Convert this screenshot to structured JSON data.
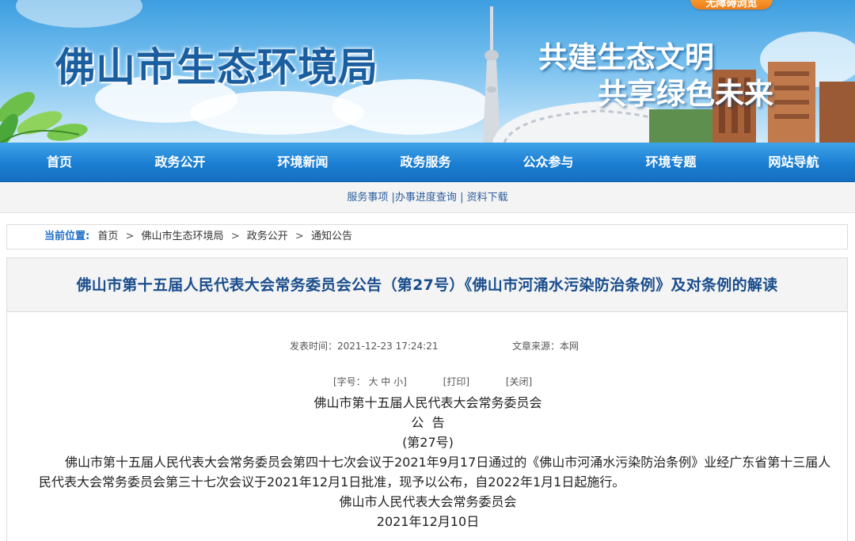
{
  "banner": {
    "title": "佛山市生态环境局",
    "slogan_line1": "共建生态文明",
    "slogan_line2": "共享绿色未来",
    "badge": "无障碍浏览"
  },
  "nav": {
    "items": [
      {
        "label": "首页"
      },
      {
        "label": "政务公开"
      },
      {
        "label": "环境新闻"
      },
      {
        "label": "政务服务"
      },
      {
        "label": "公众参与"
      },
      {
        "label": "环境专题"
      },
      {
        "label": "网站导航"
      }
    ]
  },
  "sublinks": {
    "items": [
      {
        "label": "服务事项"
      },
      {
        "label": "办事进度查询"
      },
      {
        "label": "资料下载"
      }
    ],
    "separator": "|"
  },
  "breadcrumb": {
    "label": "当前位置:",
    "items": [
      "首页",
      "佛山市生态环境局",
      "政务公开",
      "通知公告"
    ],
    "arrow": ">"
  },
  "article": {
    "title": "佛山市第十五届人民代表大会常务委员会公告（第27号）《佛山市河涌水污染防治条例》及对条例的解读",
    "date_label": "发表时间：",
    "date_value": "2021-12-23 17:24:21",
    "source_label": "文章来源：",
    "source_value": "本网",
    "tools": {
      "font_size": "[字号：  大 中 小]",
      "print": "[打印]",
      "close": "[关闭]"
    },
    "body": {
      "issuer": "佛山市第十五届人民代表大会常务委员会",
      "heading": "公  告",
      "number": "(第27号)",
      "paragraph": "佛山市第十五届人民代表大会常务委员会第四十七次会议于2021年9月17日通过的《佛山市河涌水污染防治条例》业经广东省第十三届人民代表大会常务委员会第三十七次会议于2021年12月1日批准，现予以公布，自2022年1月1日起施行。",
      "signature": "佛山市人民代表大会常务委员会",
      "sign_date": "2021年12月10日"
    }
  },
  "colors": {
    "nav_blue": "#1b7ed2",
    "title_blue": "#1a4d8c",
    "banner_title": "#1b5e9f",
    "breadcrumb_label": "#1e6fc7"
  }
}
